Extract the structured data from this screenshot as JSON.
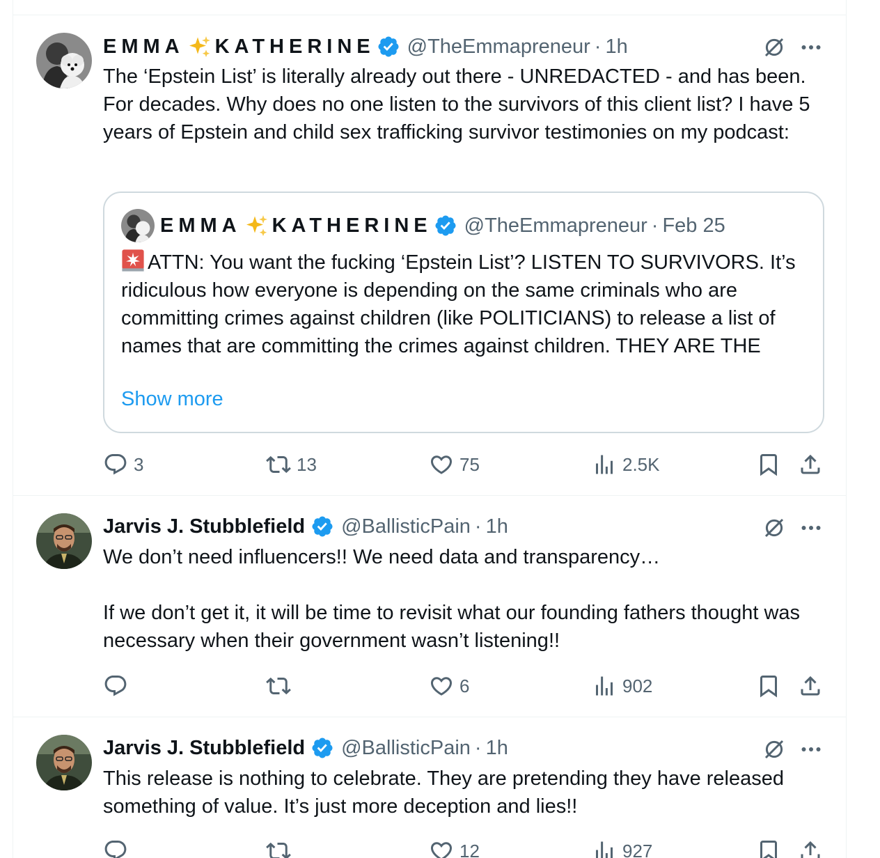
{
  "tweets": [
    {
      "name_part1": "EMMA",
      "name_part2": "KATHERINE",
      "handle": "@TheEmmapreneur",
      "dot": "·",
      "time": "1h",
      "text": "The ‘Epstein List’ is literally already out there - UNREDACTED - and has been. For decades. Why does no one listen to the survivors of this client list? I have 5 years of Epstein and child sex trafficking survivor testimonies on my podcast:",
      "quote": {
        "name_part1": "EMMA",
        "name_part2": "KATHERINE",
        "handle": "@TheEmmapreneur",
        "dot": "·",
        "time": "Feb 25",
        "text": "ATTN: You want the fucking ‘Epstein List’? LISTEN TO SURVIVORS. It’s ridiculous how everyone is depending on the same criminals who are committing crimes against children (like POLITICIANS) to release a list of names that are committing the crimes against children. THEY ARE THE",
        "show_more": "Show more"
      },
      "replies": "3",
      "reposts": "13",
      "likes": "75",
      "views": "2.5K"
    },
    {
      "name": "Jarvis J. Stubblefield",
      "handle": "@BallisticPain",
      "dot": "·",
      "time": "1h",
      "text": "We don’t need influencers!! We need data and transparency…\n\nIf we don’t get it, it will be time to revisit what our founding fathers thought was necessary when their government wasn’t listening!!",
      "replies": "",
      "reposts": "",
      "likes": "6",
      "views": "902"
    },
    {
      "name": "Jarvis J. Stubblefield",
      "handle": "@BallisticPain",
      "dot": "·",
      "time": "1h",
      "text": "This release is nothing to celebrate. They are pretending they have released something of value. It’s just more deception and lies!!",
      "replies": "",
      "reposts": "",
      "likes": "12",
      "views": "927"
    }
  ],
  "icons": {
    "reply": "reply-icon",
    "repost": "repost-icon",
    "like": "like-icon",
    "views": "views-icon",
    "bookmark": "bookmark-icon",
    "share": "share-icon",
    "grok": "grok-icon",
    "more": "more-icon",
    "verified": "verified-badge-icon",
    "sparkles": "sparkles-emoji",
    "alarm": "rotating-light-emoji"
  },
  "colors": {
    "verified": "#1d9bf0",
    "link": "#1d9bf0",
    "secondary_text": "#536471",
    "divider": "#eff3f4"
  }
}
